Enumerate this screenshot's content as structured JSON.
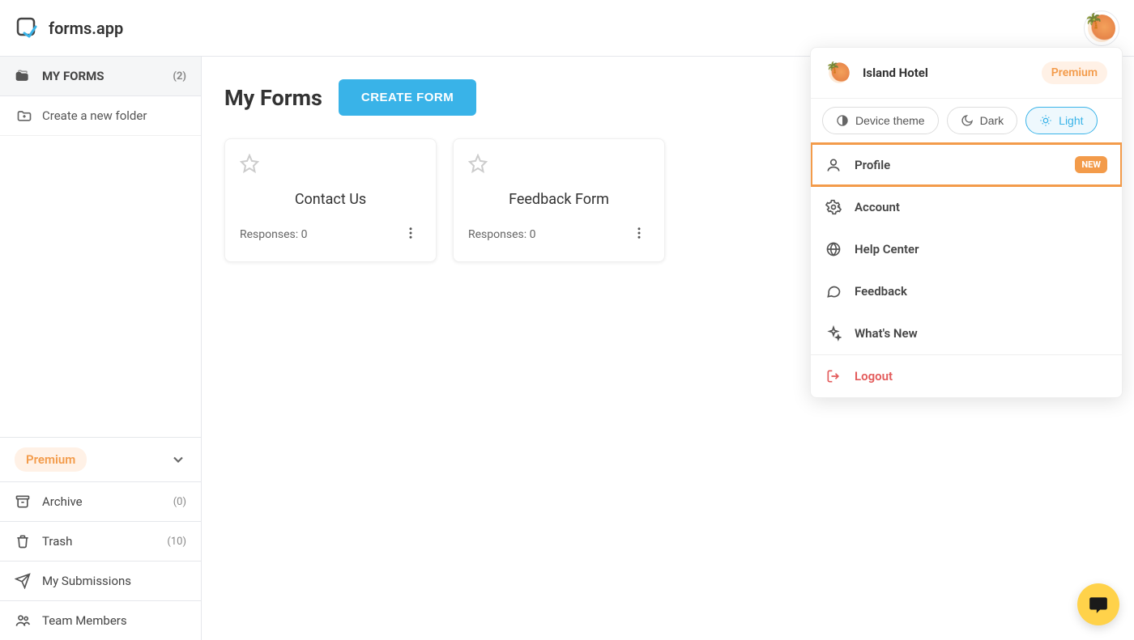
{
  "brand": "forms.app",
  "sidebar": {
    "myforms": {
      "label": "MY FORMS",
      "count": "(2)"
    },
    "newfolder": "Create a new folder",
    "premium": "Premium",
    "items": [
      {
        "id": "archive",
        "label": "Archive",
        "count": "(0)"
      },
      {
        "id": "trash",
        "label": "Trash",
        "count": "(10)"
      },
      {
        "id": "submissions",
        "label": "My Submissions"
      },
      {
        "id": "team",
        "label": "Team Members"
      }
    ]
  },
  "main": {
    "title": "My Forms",
    "create_label": "CREATE FORM",
    "forms": [
      {
        "title": "Contact Us",
        "responses": "Responses: 0"
      },
      {
        "title": "Feedback Form",
        "responses": "Responses: 0"
      }
    ]
  },
  "user_menu": {
    "name": "Island Hotel",
    "premium": "Premium",
    "themes": {
      "device": "Device theme",
      "dark": "Dark",
      "light": "Light"
    },
    "profile": {
      "label": "Profile",
      "badge": "NEW"
    },
    "account": "Account",
    "help": "Help Center",
    "feedback": "Feedback",
    "whatsnew": "What's New",
    "logout": "Logout"
  }
}
